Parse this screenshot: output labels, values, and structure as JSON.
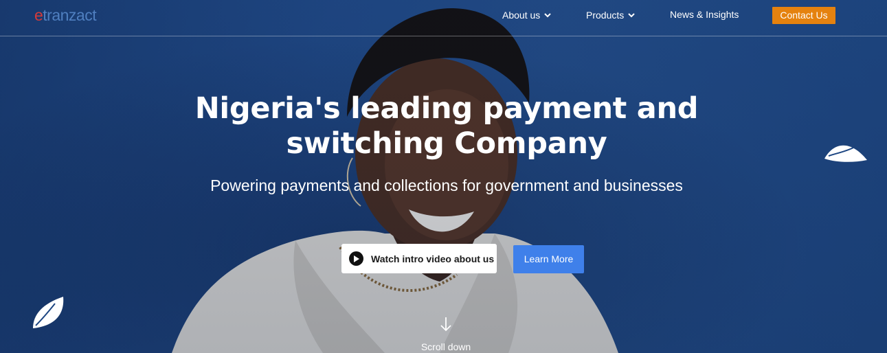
{
  "brand": {
    "logo_e": "e",
    "logo_rest": "tranzact"
  },
  "nav": {
    "items": [
      {
        "label": "About us",
        "has_dropdown": true
      },
      {
        "label": "Products",
        "has_dropdown": true
      },
      {
        "label": "News & Insights",
        "has_dropdown": false
      }
    ],
    "contact_label": "Contact Us"
  },
  "hero": {
    "title_line1": "Nigeria's leading payment and",
    "title_line2": "switching Company",
    "subtitle": "Powering payments and collections for government and businesses",
    "watch_label": "Watch intro video about us",
    "learn_label": "Learn More",
    "scroll_label": "Scroll down"
  },
  "colors": {
    "background": "#1d4682",
    "contact_button": "#e5820f",
    "learn_button": "#3f80ea",
    "logo_accent": "#d33a3a",
    "logo_text": "#4f7fc0"
  },
  "icons": {
    "dropdown": "chevron-down-icon",
    "play": "play-icon",
    "scroll": "arrow-down-icon",
    "decor_right": "leaf-icon",
    "decor_left": "leaf-icon"
  }
}
